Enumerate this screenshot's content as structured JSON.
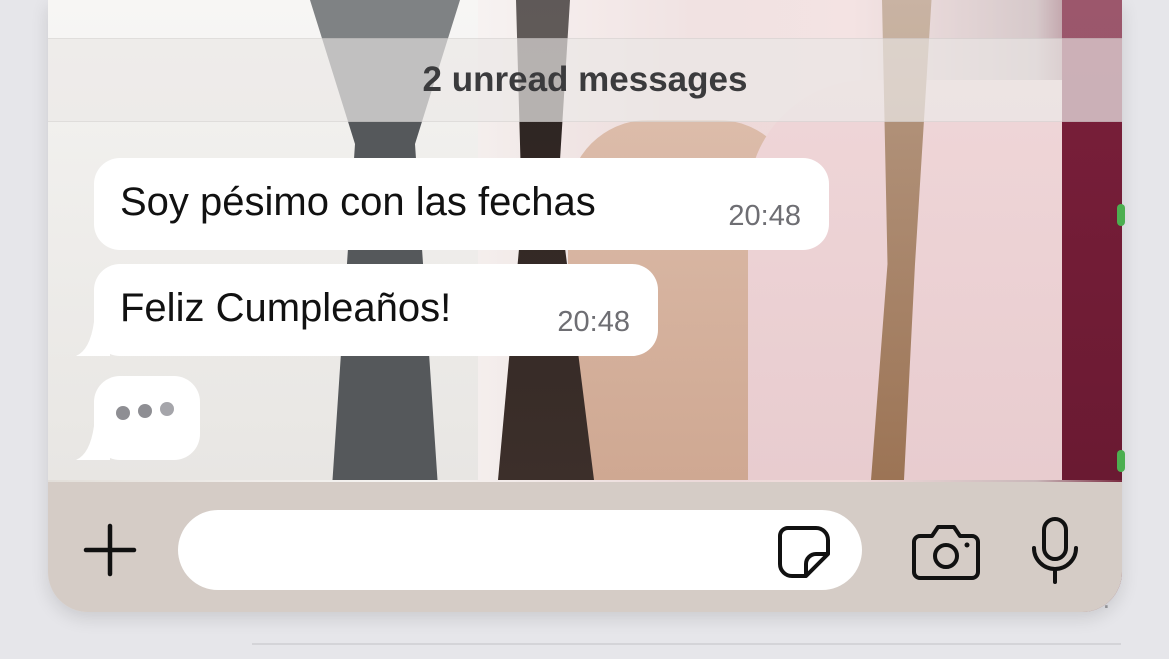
{
  "chat": {
    "unread_banner": "2 unread messages",
    "messages": [
      {
        "text": "Soy pésimo con las fechas",
        "time": "20:48"
      },
      {
        "text": "Feliz Cumpleaños!",
        "time": "20:48"
      }
    ],
    "typing_indicator": "•••"
  },
  "composer": {
    "input_value": "",
    "placeholder": "",
    "icons": {
      "attach": "plus-icon",
      "sticker": "sticker-icon",
      "camera": "camera-icon",
      "mic": "microphone-icon"
    }
  },
  "background_list": {
    "more_dots": "..."
  },
  "colors": {
    "bubble": "#ffffff",
    "input_bar": "#d5ccc6",
    "icon": "#111111",
    "time_text": "#6e6e73"
  }
}
